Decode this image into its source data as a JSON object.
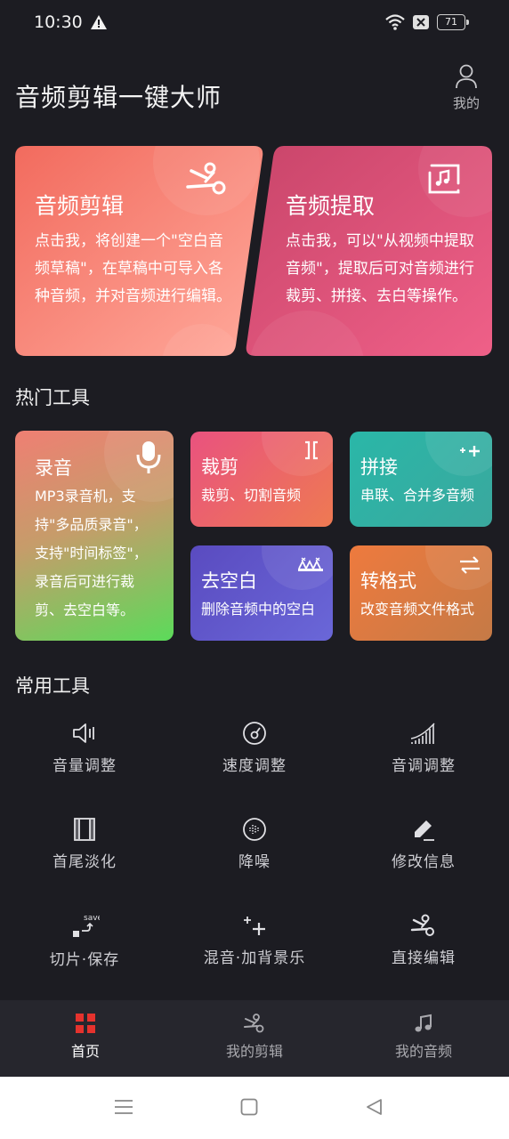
{
  "status_bar": {
    "time": "10:30",
    "battery": "71"
  },
  "header": {
    "title": "音频剪辑一键大师",
    "me_label": "我的"
  },
  "feature_cards": [
    {
      "title": "音频剪辑",
      "desc_lines": [
        "点击我，将创建一个\"空白音",
        "频草稿\"，在草稿中可导入各",
        "种音频，并对音频进行编辑。"
      ],
      "colors": [
        "#f26b5e",
        "#ffa494"
      ]
    },
    {
      "title": "音频提取",
      "desc_lines": [
        "点击我，可以\"从视频中提取",
        "音频\"，提取后可对音频进行",
        "裁剪、拼接、去白等操作。"
      ],
      "colors": [
        "#c94468",
        "#ee5f86"
      ]
    }
  ],
  "hot_tools": {
    "title": "热门工具",
    "record": {
      "title": "录音",
      "desc_lines": [
        "MP3录音机，支",
        "持\"多品质录音\"，",
        "支持\"时间标签\"，",
        "录音后可进行裁",
        "剪、去空白等。"
      ]
    },
    "cut": {
      "title": "裁剪",
      "desc": "裁剪、切割音频"
    },
    "join": {
      "title": "拼接",
      "desc": "串联、合并多音频"
    },
    "silence": {
      "title": "去空白",
      "desc": "删除音频中的空白"
    },
    "convert": {
      "title": "转格式",
      "desc": "改变音频文件格式"
    }
  },
  "common_tools": {
    "title": "常用工具",
    "items": [
      {
        "label": "音量调整",
        "icon": "volume-icon"
      },
      {
        "label": "速度调整",
        "icon": "speed-gauge-icon"
      },
      {
        "label": "音调调整",
        "icon": "pitch-bars-icon"
      },
      {
        "label": "首尾淡化",
        "icon": "fade-icon"
      },
      {
        "label": "降噪",
        "icon": "denoise-icon"
      },
      {
        "label": "修改信息",
        "icon": "edit-pen-icon"
      },
      {
        "label": "切片·保存",
        "icon": "slice-save-icon",
        "icon_text": "save"
      },
      {
        "label": "混音·加背景乐",
        "icon": "mix-plus-icon"
      },
      {
        "label": "直接编辑",
        "icon": "scissors-icon"
      }
    ]
  },
  "bottom_nav": {
    "items": [
      {
        "label": "首页",
        "icon": "home-grid-icon",
        "active": true
      },
      {
        "label": "我的剪辑",
        "icon": "scissors-icon"
      },
      {
        "label": "我的音频",
        "icon": "music-note-icon"
      }
    ],
    "active_color": "#e5322d"
  }
}
